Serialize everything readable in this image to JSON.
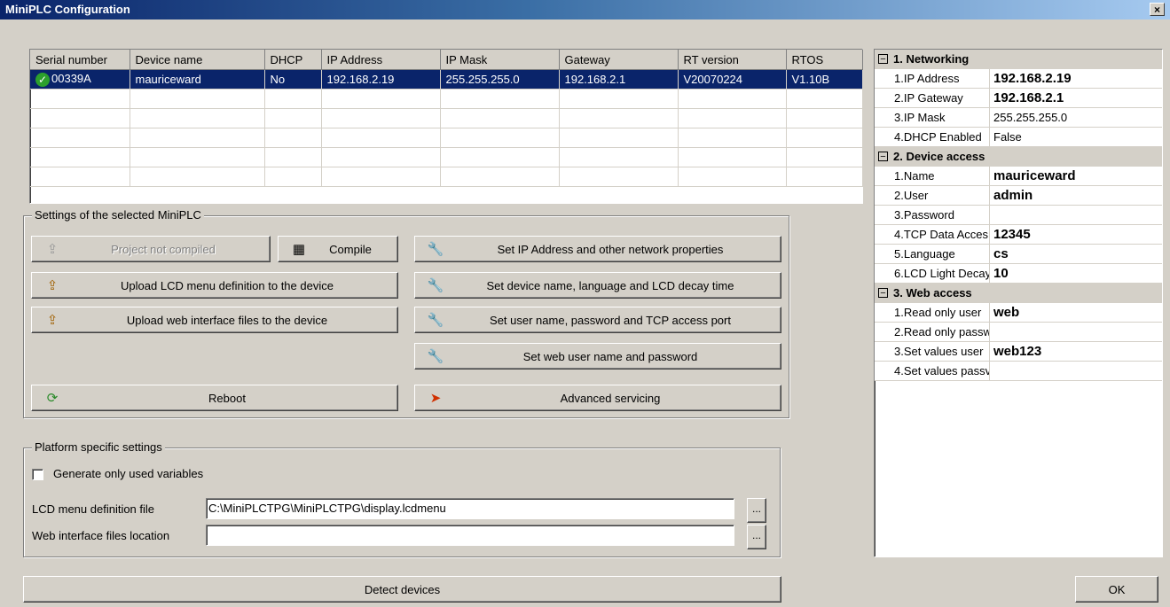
{
  "window": {
    "title": "MiniPLC Configuration",
    "close": "×"
  },
  "device_table": {
    "columns": [
      "Serial number",
      "Device name",
      "DHCP",
      "IP Address",
      "IP Mask",
      "Gateway",
      "RT version",
      "RTOS"
    ],
    "rows": [
      {
        "serial": "00339A",
        "name": "mauriceward",
        "dhcp": "No",
        "ip": "192.168.2.19",
        "mask": "255.255.255.0",
        "gateway": "192.168.2.1",
        "rt": "V20070224",
        "rtos": "V1.10B"
      }
    ]
  },
  "settings": {
    "legend": "Settings of the selected MiniPLC",
    "project_not_compiled": "Project not compiled",
    "compile": "Compile",
    "upload_lcd": "Upload LCD menu definition to the device",
    "upload_web": "Upload web interface files to the device",
    "reboot": "Reboot",
    "set_ip": "Set IP Address and other network properties",
    "set_device_name": "Set device name, language and LCD  decay time",
    "set_user": "Set user name, password and TCP access port",
    "set_web_user": "Set web user name and password",
    "advanced": "Advanced servicing"
  },
  "platform": {
    "legend": "Platform specific settings",
    "generate_used": "Generate only used variables",
    "lcd_label": "LCD menu definition file",
    "lcd_value": "C:\\MiniPLCTPG\\MiniPLCTPG\\display.lcdmenu",
    "web_label": "Web interface files location",
    "web_value": "",
    "browse": "..."
  },
  "detect": "Detect devices",
  "ok": "OK",
  "props": {
    "cat1": "1. Networking",
    "ip_address": {
      "name": "1.IP Address",
      "value": "192.168.2.19"
    },
    "ip_gateway": {
      "name": "2.IP Gateway",
      "value": "192.168.2.1"
    },
    "ip_mask": {
      "name": "3.IP Mask",
      "value": "255.255.255.0"
    },
    "dhcp": {
      "name": "4.DHCP Enabled",
      "value": "False"
    },
    "cat2": "2. Device access",
    "name": {
      "name": "1.Name",
      "value": "mauriceward"
    },
    "user": {
      "name": "2.User",
      "value": "admin"
    },
    "password": {
      "name": "3.Password",
      "value": ""
    },
    "tcp": {
      "name": "4.TCP Data Acces",
      "value": "12345"
    },
    "language": {
      "name": "5.Language",
      "value": "cs"
    },
    "lcd_decay": {
      "name": "6.LCD Light Decay",
      "value": "10"
    },
    "cat3": "3. Web access",
    "ro_user": {
      "name": "1.Read only user",
      "value": "web"
    },
    "ro_pass": {
      "name": "2.Read only passw",
      "value": ""
    },
    "sv_user": {
      "name": "3.Set values user",
      "value": "web123"
    },
    "sv_pass": {
      "name": "4.Set values passv",
      "value": ""
    }
  }
}
